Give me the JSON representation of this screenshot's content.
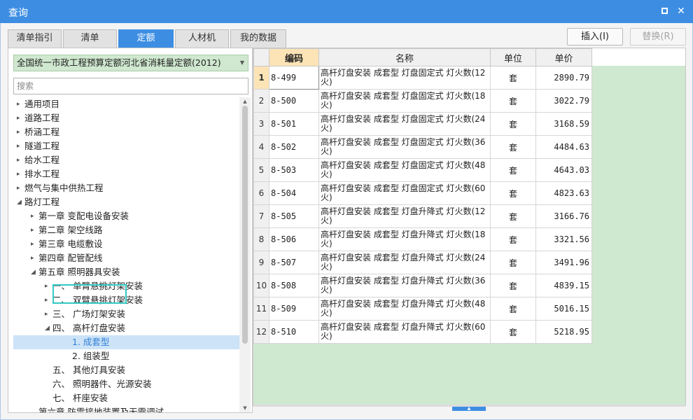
{
  "window": {
    "title": "查询",
    "maximize_icon": "maximize-icon",
    "close_icon": "close-icon",
    "close_glyph": "✕"
  },
  "tabs": [
    {
      "label": "清单指引",
      "active": false
    },
    {
      "label": "清单",
      "active": false
    },
    {
      "label": "定额",
      "active": true
    },
    {
      "label": "人材机",
      "active": false
    },
    {
      "label": "我的数据",
      "active": false
    }
  ],
  "actions": {
    "insert_label": "插入(I)",
    "replace_label": "替换(R)"
  },
  "library": {
    "selected": "全国统一市政工程预算定额河北省消耗量定额(2012)"
  },
  "search": {
    "placeholder": "搜索"
  },
  "tree": [
    {
      "label": "通用项目",
      "level": 0,
      "arrow": "▸"
    },
    {
      "label": "道路工程",
      "level": 0,
      "arrow": "▸"
    },
    {
      "label": "桥涵工程",
      "level": 0,
      "arrow": "▸"
    },
    {
      "label": "隧道工程",
      "level": 0,
      "arrow": "▸"
    },
    {
      "label": "给水工程",
      "level": 0,
      "arrow": "▸"
    },
    {
      "label": "排水工程",
      "level": 0,
      "arrow": "▸"
    },
    {
      "label": "燃气与集中供热工程",
      "level": 0,
      "arrow": "▸"
    },
    {
      "label": "路灯工程",
      "level": 0,
      "arrow": "◢"
    },
    {
      "label": "第一章 变配电设备安装",
      "level": 1,
      "arrow": "▸"
    },
    {
      "label": "第二章 架空线路",
      "level": 1,
      "arrow": "▸"
    },
    {
      "label": "第三章 电缆敷设",
      "level": 1,
      "arrow": "▸"
    },
    {
      "label": "第四章 配管配线",
      "level": 1,
      "arrow": "▸"
    },
    {
      "label": "第五章 照明器具安装",
      "level": 1,
      "arrow": "◢"
    },
    {
      "label": "一、 单臂悬挑灯架安装",
      "level": 2,
      "arrow": "▸"
    },
    {
      "label": "二、 双臂悬挑灯架安装",
      "level": 2,
      "arrow": "▸"
    },
    {
      "label": "三、 广场灯架安装",
      "level": 2,
      "arrow": "▸"
    },
    {
      "label": "四、 高杆灯盘安装",
      "level": 2,
      "arrow": "◢"
    },
    {
      "label": "1. 成套型",
      "level": 3,
      "arrow": "",
      "selected": true
    },
    {
      "label": "2. 组装型",
      "level": 3,
      "arrow": ""
    },
    {
      "label": "五、 其他灯具安装",
      "level": 2,
      "arrow": ""
    },
    {
      "label": "六、 照明器件、光源安装",
      "level": 2,
      "arrow": ""
    },
    {
      "label": "七、 杆座安装",
      "level": 2,
      "arrow": ""
    },
    {
      "label": "第六章 防雷接地装置及无需调试",
      "level": 1,
      "arrow": ""
    }
  ],
  "grid": {
    "columns": [
      "编码",
      "名称",
      "单位",
      "单价"
    ],
    "rows": [
      {
        "no": "1",
        "code": "8-499",
        "name": "高杆灯盘安装 成套型 灯盘固定式 灯火数(12火)",
        "unit": "套",
        "price": "2890.79"
      },
      {
        "no": "2",
        "code": "8-500",
        "name": "高杆灯盘安装 成套型 灯盘固定式 灯火数(18火)",
        "unit": "套",
        "price": "3022.79"
      },
      {
        "no": "3",
        "code": "8-501",
        "name": "高杆灯盘安装 成套型 灯盘固定式 灯火数(24火)",
        "unit": "套",
        "price": "3168.59"
      },
      {
        "no": "4",
        "code": "8-502",
        "name": "高杆灯盘安装 成套型 灯盘固定式 灯火数(36火)",
        "unit": "套",
        "price": "4484.63"
      },
      {
        "no": "5",
        "code": "8-503",
        "name": "高杆灯盘安装 成套型 灯盘固定式 灯火数(48火)",
        "unit": "套",
        "price": "4643.03"
      },
      {
        "no": "6",
        "code": "8-504",
        "name": "高杆灯盘安装 成套型 灯盘固定式 灯火数(60火)",
        "unit": "套",
        "price": "4823.63"
      },
      {
        "no": "7",
        "code": "8-505",
        "name": "高杆灯盘安装 成套型 灯盘升降式 灯火数(12火)",
        "unit": "套",
        "price": "3166.76"
      },
      {
        "no": "8",
        "code": "8-506",
        "name": "高杆灯盘安装 成套型 灯盘升降式 灯火数(18火)",
        "unit": "套",
        "price": "3321.56"
      },
      {
        "no": "9",
        "code": "8-507",
        "name": "高杆灯盘安装 成套型 灯盘升降式 灯火数(24火)",
        "unit": "套",
        "price": "3491.96"
      },
      {
        "no": "10",
        "code": "8-508",
        "name": "高杆灯盘安装 成套型 灯盘升降式 灯火数(36火)",
        "unit": "套",
        "price": "4839.15"
      },
      {
        "no": "11",
        "code": "8-509",
        "name": "高杆灯盘安装 成套型 灯盘升降式 灯火数(48火)",
        "unit": "套",
        "price": "5016.15"
      },
      {
        "no": "12",
        "code": "8-510",
        "name": "高杆灯盘安装 成套型 灯盘升降式 灯火数(60火)",
        "unit": "套",
        "price": "5218.95"
      }
    ]
  },
  "colors": {
    "accent": "#3d8ee3",
    "library_bg": "#cfe8cf",
    "grid_empty_bg": "#cfe8d0",
    "header_highlight": "#fce4b6",
    "selection": "#cce3f8",
    "focus_outline": "#34c9c3"
  }
}
